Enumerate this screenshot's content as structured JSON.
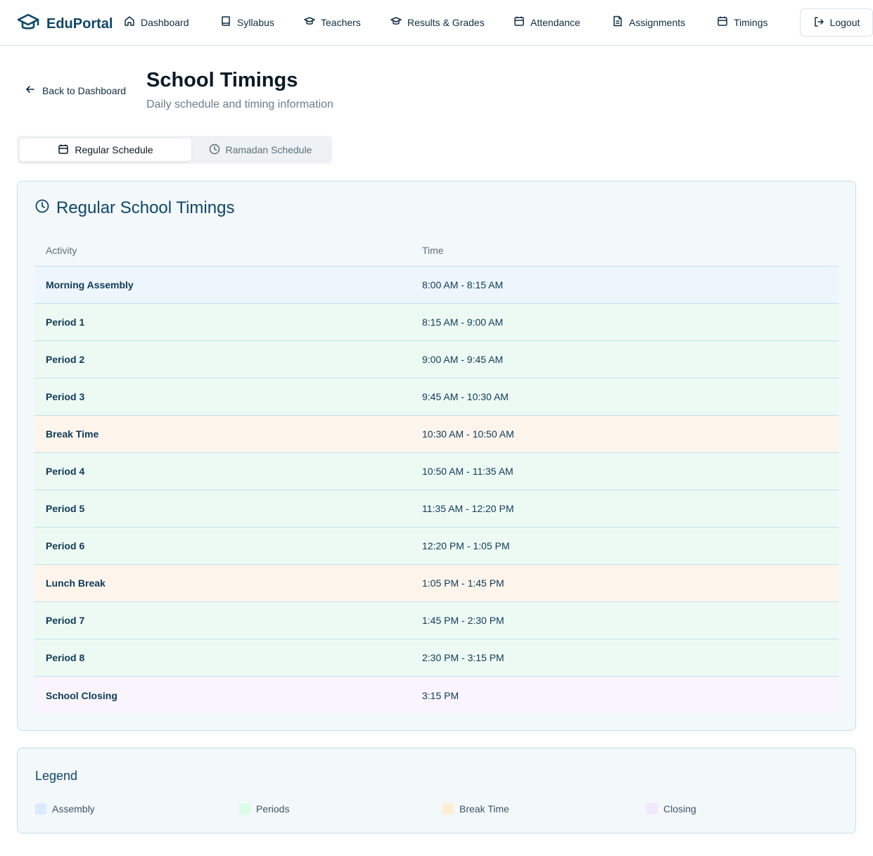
{
  "brand": {
    "name": "EduPortal"
  },
  "nav": [
    {
      "label": "Dashboard",
      "icon": "home-icon"
    },
    {
      "label": "Syllabus",
      "icon": "book-icon"
    },
    {
      "label": "Teachers",
      "icon": "graduation-cap-icon"
    },
    {
      "label": "Results & Grades",
      "icon": "graduation-cap-icon"
    },
    {
      "label": "Attendance",
      "icon": "calendar-icon"
    },
    {
      "label": "Assignments",
      "icon": "document-icon"
    },
    {
      "label": "Timings",
      "icon": "calendar-icon"
    }
  ],
  "logout_label": "Logout",
  "back_label": "Back to Dashboard",
  "page": {
    "title": "School Timings",
    "subtitle": "Daily schedule and timing information"
  },
  "tabs": [
    {
      "label": "Regular Schedule",
      "active": true
    },
    {
      "label": "Ramadan Schedule",
      "active": false
    }
  ],
  "card": {
    "title": "Regular School Timings",
    "headers": {
      "activity": "Activity",
      "time": "Time"
    },
    "rows": [
      {
        "activity": "Morning Assembly",
        "time": "8:00 AM - 8:15 AM",
        "type": "assembly"
      },
      {
        "activity": "Period 1",
        "time": "8:15 AM - 9:00 AM",
        "type": "period"
      },
      {
        "activity": "Period 2",
        "time": "9:00 AM - 9:45 AM",
        "type": "period"
      },
      {
        "activity": "Period 3",
        "time": "9:45 AM - 10:30 AM",
        "type": "period"
      },
      {
        "activity": "Break Time",
        "time": "10:30 AM - 10:50 AM",
        "type": "break"
      },
      {
        "activity": "Period 4",
        "time": "10:50 AM - 11:35 AM",
        "type": "period"
      },
      {
        "activity": "Period 5",
        "time": "11:35 AM - 12:20 PM",
        "type": "period"
      },
      {
        "activity": "Period 6",
        "time": "12:20 PM - 1:05 PM",
        "type": "period"
      },
      {
        "activity": "Lunch Break",
        "time": "1:05 PM - 1:45 PM",
        "type": "break"
      },
      {
        "activity": "Period 7",
        "time": "1:45 PM - 2:30 PM",
        "type": "period"
      },
      {
        "activity": "Period 8",
        "time": "2:30 PM - 3:15 PM",
        "type": "period"
      },
      {
        "activity": "School Closing",
        "time": "3:15 PM",
        "type": "closing"
      }
    ]
  },
  "row_colors": {
    "assembly": "#edf5fd",
    "period": "#edfaf3",
    "break": "#fdf4ec",
    "closing": "#f9f4fd"
  },
  "legend": {
    "title": "Legend",
    "items": [
      {
        "label": "Assembly",
        "color": "#dbeafe"
      },
      {
        "label": "Periods",
        "color": "#dcfce7"
      },
      {
        "label": "Break Time",
        "color": "#ffedd5"
      },
      {
        "label": "Closing",
        "color": "#f3e8ff"
      }
    ]
  }
}
